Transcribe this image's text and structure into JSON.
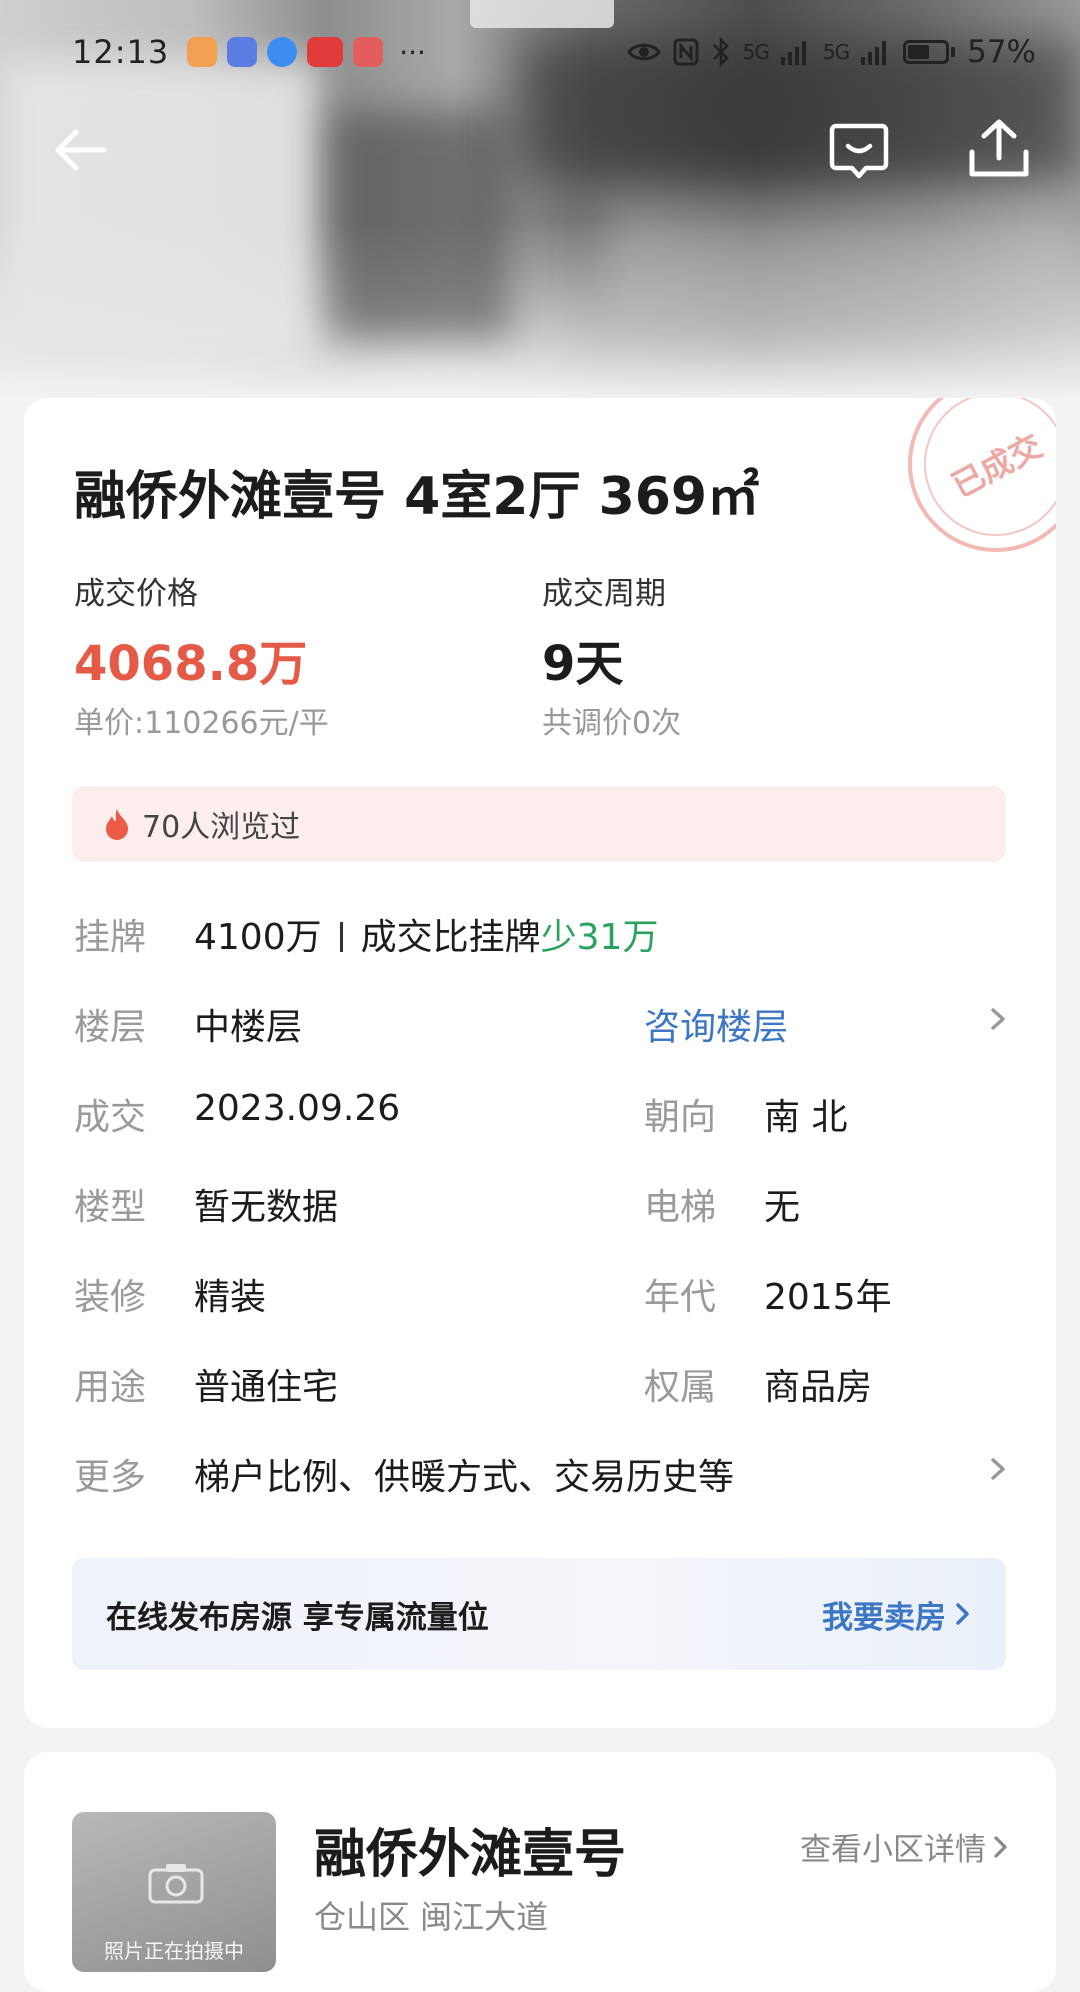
{
  "status_bar": {
    "time": "12:13",
    "more_indicator": "···",
    "signal1": "5G",
    "signal2": "5G",
    "battery_percent_label": "57%",
    "battery_level": 0.57,
    "icons": [
      "eye-comfort-icon",
      "nfc-icon",
      "bluetooth-icon",
      "signal-icon",
      "battery-icon"
    ]
  },
  "nav": {
    "icons": [
      "back-arrow-icon",
      "message-icon",
      "share-icon"
    ]
  },
  "listing": {
    "title": "融侨外滩壹号 4室2厅 369㎡",
    "stamp_text": "已成交",
    "deal_price_label": "成交价格",
    "deal_price": "4068.8万",
    "unit_price": "单价:110266元/平",
    "deal_period_label": "成交周期",
    "deal_period": "9天",
    "price_adjustments": "共调价0次",
    "views_text": "70人浏览过"
  },
  "details": {
    "listing": {
      "label": "挂牌",
      "value": "4100万",
      "compare_prefix": "成交比挂牌",
      "compare_value": "少31万"
    },
    "floor": {
      "label": "楼层",
      "value": "中楼层",
      "link": "咨询楼层"
    },
    "deal": {
      "label": "成交",
      "value": "2023.09.26",
      "label2": "朝向",
      "value2": "南 北"
    },
    "building_type": {
      "label": "楼型",
      "value": "暂无数据",
      "label2": "电梯",
      "value2": "无"
    },
    "decoration": {
      "label": "装修",
      "value": "精装",
      "label2": "年代",
      "value2": "2015年"
    },
    "usage": {
      "label": "用途",
      "value": "普通住宅",
      "label2": "权属",
      "value2": "商品房"
    },
    "more": {
      "label": "更多",
      "value": "梯户比例、供暖方式、交易历史等"
    }
  },
  "banner": {
    "text": "在线发布房源 享专属流量位",
    "cta": "我要卖房"
  },
  "community": {
    "name": "融侨外滩壹号",
    "address": "仓山区 闽江大道",
    "link": "查看小区详情",
    "thumb_caption": "照片正在拍摄中"
  },
  "colors": {
    "price_red": "#e45a47",
    "link_blue": "#3c76c4",
    "discount_green": "#2aa25f"
  }
}
